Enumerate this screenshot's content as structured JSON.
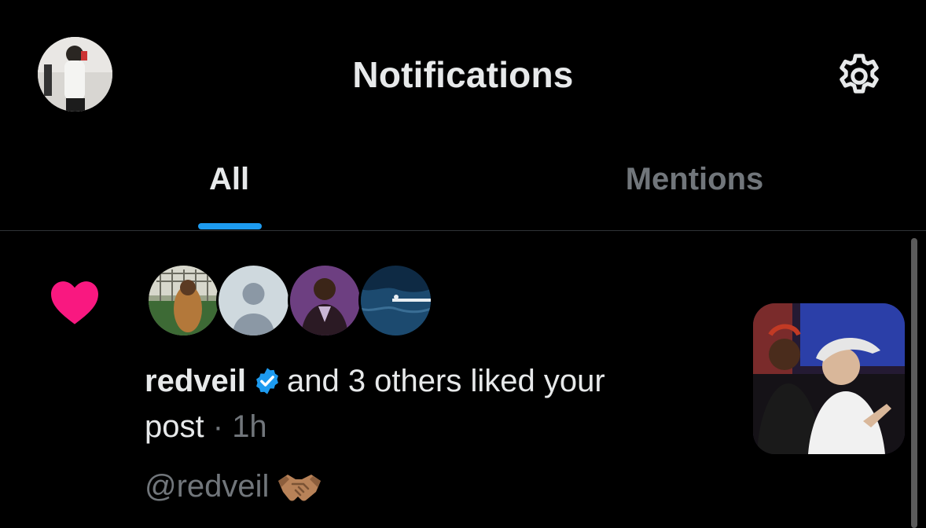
{
  "header": {
    "title": "Notifications",
    "profile_icon": "profile-avatar",
    "settings_icon": "gear-icon"
  },
  "tabs": [
    {
      "label": "All",
      "active": true
    },
    {
      "label": "Mentions",
      "active": false
    }
  ],
  "notification": {
    "type_icon": "heart-icon",
    "actor_name": "redveil",
    "verified_icon": "verified-badge-icon",
    "line1_text": "and 3 others liked your",
    "line2_text": "post",
    "separator": "·",
    "time": "1h",
    "handle": "@redveil",
    "emoji_icon": "handshake-emoji-icon",
    "avatar_count": 4
  },
  "colors": {
    "background": "#000000",
    "text_primary": "#e7e9ea",
    "text_secondary": "#71767b",
    "accent_blue": "#1d9bf0",
    "heart_pink": "#f91880"
  }
}
